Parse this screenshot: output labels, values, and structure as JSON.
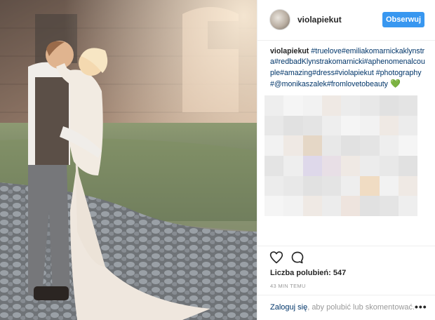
{
  "post": {
    "username": "violapiekut",
    "follow_label": "Obserwuj",
    "caption": {
      "user": "violapiekut",
      "text": " #truelove#emiliakomarnickaklynstra#redbadKlynstrakomarnicki#aphenomenalcouple#amazing#dress#violapiekut #photography #@monikaszalek#fromlovetobeauty",
      "emoji": "💚"
    },
    "likes_text": "Liczba polubień: 547",
    "time_text": "43 MIN TEMU",
    "login_prompt": {
      "link": "Zaloguj się",
      "rest": ", aby polubić lub skomentować."
    },
    "more_label": "•••",
    "icons": {
      "like": "heart-outline-icon",
      "comment": "comment-bubble-icon",
      "more": "more-options-icon"
    },
    "colors": {
      "follow_button": "#3897f0",
      "link": "#003569",
      "heart_emoji": "#2ca02c"
    }
  }
}
